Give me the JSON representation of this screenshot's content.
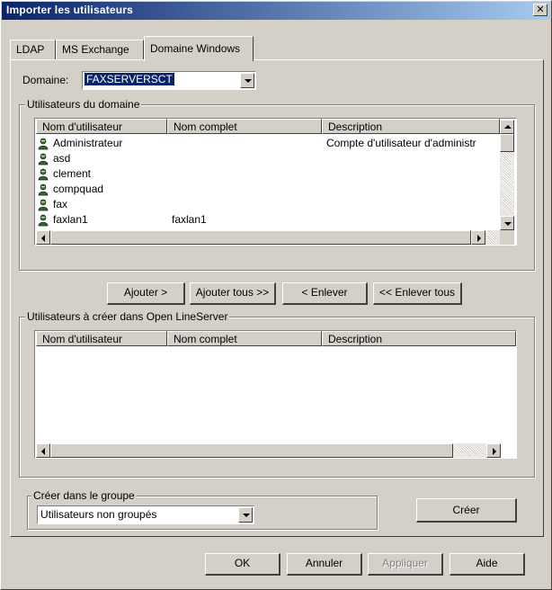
{
  "window": {
    "title": "Importer les utilisateurs",
    "close_glyph": "✕"
  },
  "tabs": [
    {
      "label": "LDAP",
      "active": false
    },
    {
      "label": "MS Exchange",
      "active": false
    },
    {
      "label": "Domaine Windows",
      "active": true
    }
  ],
  "domain": {
    "label": "Domaine:",
    "value": "FAXSERVERSCT"
  },
  "domain_users": {
    "group_label": "Utilisateurs du domaine",
    "columns": [
      "Nom d'utilisateur",
      "Nom complet",
      "Description"
    ],
    "rows": [
      {
        "name": "Administrateur",
        "full_name": "",
        "description": "Compte d'utilisateur d'administr"
      },
      {
        "name": "asd",
        "full_name": "",
        "description": ""
      },
      {
        "name": "clement",
        "full_name": "",
        "description": ""
      },
      {
        "name": "compquad",
        "full_name": "",
        "description": ""
      },
      {
        "name": "fax",
        "full_name": "",
        "description": ""
      },
      {
        "name": "faxlan1",
        "full_name": "faxlan1",
        "description": ""
      }
    ]
  },
  "actions": {
    "add": "Ajouter >",
    "add_all": "Ajouter tous >>",
    "remove": "< Enlever",
    "remove_all": "<< Enlever tous"
  },
  "users_to_create": {
    "group_label": "Utilisateurs à créer dans Open LineServer",
    "columns": [
      "Nom d'utilisateur",
      "Nom complet",
      "Description"
    ],
    "rows": []
  },
  "group": {
    "label": "Créer dans le groupe",
    "value": "Utilisateurs non groupés"
  },
  "create_button": "Créer",
  "footer": {
    "ok": "OK",
    "cancel": "Annuler",
    "apply": "Appliquer",
    "help": "Aide"
  },
  "colors": {
    "face": "#d4d0c8",
    "title_start": "#0a246a",
    "title_end": "#a6caf0",
    "selection": "#0a246a"
  }
}
